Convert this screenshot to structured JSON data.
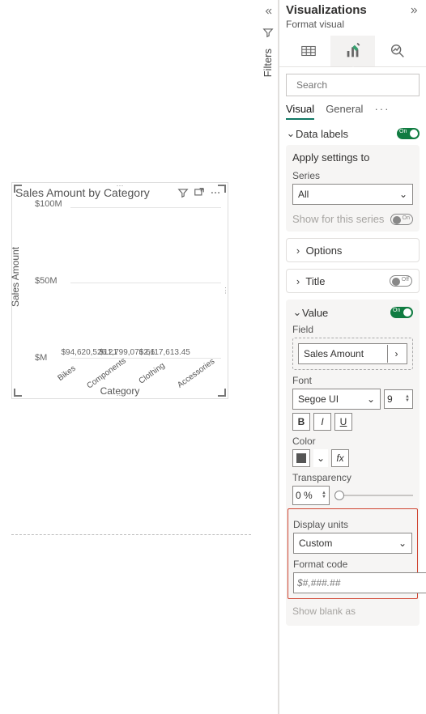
{
  "chart_data": {
    "type": "bar",
    "title": "Sales Amount by Category",
    "xlabel": "Category",
    "ylabel": "Sales Amount",
    "categories": [
      "Bikes",
      "Components",
      "Clothing",
      "Accessories"
    ],
    "values": [
      94620526.21,
      11799076.66,
      2117613.45,
      700000
    ],
    "value_labels": [
      "$94,620,526.21",
      "$11,799,076.66",
      "$2,117,613.45",
      ""
    ],
    "ylim": [
      0,
      100000000
    ],
    "yticks": [
      {
        "v": 0,
        "label": "$M"
      },
      {
        "v": 50000000,
        "label": "$50M"
      },
      {
        "v": 100000000,
        "label": "$100M"
      }
    ]
  },
  "filters_label": "Filters",
  "panel": {
    "title": "Visualizations",
    "subtitle": "Format visual",
    "search_placeholder": "Search",
    "tabs": {
      "visual": "Visual",
      "general": "General"
    },
    "sections": {
      "data_labels": {
        "label": "Data labels",
        "on": "On"
      },
      "apply": {
        "title": "Apply settings to",
        "series_label": "Series",
        "series_value": "All",
        "show_for_series": "Show for this series",
        "show_on": "On"
      },
      "options": "Options",
      "title_row": {
        "label": "Title",
        "off": "Off"
      },
      "value": {
        "label": "Value",
        "on": "On",
        "field_label": "Field",
        "field_value": "Sales Amount",
        "font_label": "Font",
        "font_value": "Segoe UI",
        "font_size": "9",
        "b": "B",
        "i": "I",
        "u": "U",
        "color_label": "Color",
        "transparency_label": "Transparency",
        "transparency_value": "0 %",
        "display_units_label": "Display units",
        "display_units_value": "Custom",
        "format_code_label": "Format code",
        "format_code_value": "$#,###.##",
        "fx": "fx",
        "blank": "Show blank as"
      }
    }
  }
}
